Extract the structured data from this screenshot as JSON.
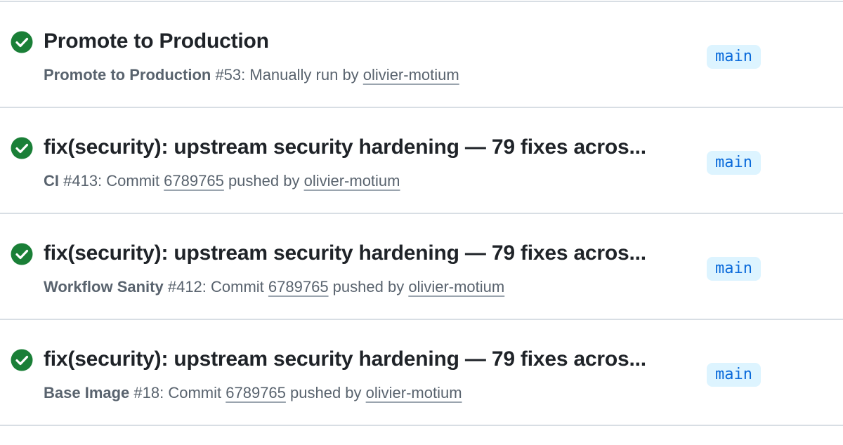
{
  "colors": {
    "success": "#1a7f37",
    "badge_bg": "#ddf4ff",
    "badge_text": "#0969da",
    "muted_text": "#59636e",
    "title_text": "#1f2328"
  },
  "runs": [
    {
      "status_icon": "check-circle-icon",
      "title": "Promote to Production",
      "workflow": "Promote to Production",
      "run_number": " #53: ",
      "event_text": "Manually run by ",
      "actor": "olivier-motium",
      "branch": "main"
    },
    {
      "status_icon": "check-circle-icon",
      "title": "fix(security): upstream security hardening — 79 fixes acros...",
      "workflow": "CI",
      "run_number": " #413: ",
      "event_text": "Commit ",
      "commit": "6789765",
      "pushed_text": " pushed by ",
      "actor": "olivier-motium",
      "branch": "main"
    },
    {
      "status_icon": "check-circle-icon",
      "title": "fix(security): upstream security hardening — 79 fixes acros...",
      "workflow": "Workflow Sanity",
      "run_number": " #412: ",
      "event_text": "Commit ",
      "commit": "6789765",
      "pushed_text": " pushed by ",
      "actor": "olivier-motium",
      "branch": "main"
    },
    {
      "status_icon": "check-circle-icon",
      "title": "fix(security): upstream security hardening — 79 fixes acros...",
      "workflow": "Base Image",
      "run_number": " #18: ",
      "event_text": "Commit ",
      "commit": "6789765",
      "pushed_text": " pushed by ",
      "actor": "olivier-motium",
      "branch": "main"
    }
  ]
}
